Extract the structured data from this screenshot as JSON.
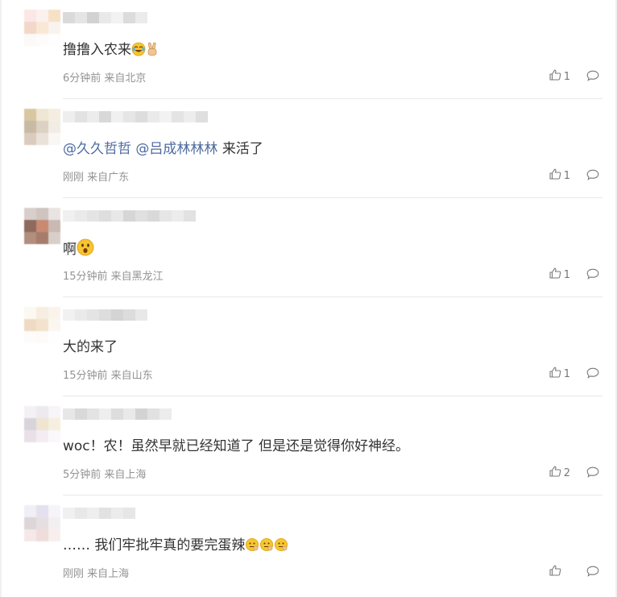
{
  "comments": [
    {
      "text": "撸撸入农来",
      "meta": "6分钟前 来自北京",
      "likes": "1",
      "avatar_colors": [
        "#fbe7e3",
        "#fbf1ee",
        "#f6e0c6",
        "#f3d7c9",
        "#fae8d7",
        "#f8f3ee",
        "#fcfaf7",
        "#fdfcfb",
        "#fefefe"
      ],
      "name_colors": [
        "#dadada",
        "#e5e5e5",
        "#d2d2d2",
        "#e9e9e9",
        "#f2f2f2",
        "#dcdcdc",
        "#ebebeb"
      ],
      "emojis": [
        "laughing-tears-emoji",
        "victory-hand-emoji"
      ]
    },
    {
      "mention1": "@久久哲哲",
      "mention2": "@吕成林林林",
      "text": "来活了",
      "meta": "刚刚 来自广东",
      "likes": "1",
      "avatar_colors": [
        "#d8c7a1",
        "#efe6d3",
        "#f4ede0",
        "#c9baa6",
        "#dcd1c2",
        "#f1ece4",
        "#d9ccbf",
        "#e9e2d9",
        "#f9f7f4"
      ],
      "name_colors": [
        "#eeeeee",
        "#e2e2e2",
        "#ececec",
        "#d8d8d8",
        "#f0f0f0",
        "#e6e6e6",
        "#dddddd",
        "#eaeaea",
        "#f2f2f2",
        "#e4e4e4",
        "#ededed",
        "#dfdfdf"
      ]
    },
    {
      "text": "啊",
      "meta": "15分钟前 来自黑龙江",
      "likes": "1",
      "avatar_colors": [
        "#d8cfcb",
        "#cfc4bf",
        "#e9e4e2",
        "#8f6a5e",
        "#c98a72",
        "#c9b9b2",
        "#b28e7f",
        "#a67d6c",
        "#d9cfc9"
      ],
      "name_colors": [
        "#f0f0f0",
        "#eaeaea",
        "#e4e4e4",
        "#dedede",
        "#e8e8e8",
        "#d6d6d6",
        "#e0e0e0",
        "#d9d9d9",
        "#e6e6e6",
        "#ececec",
        "#e2e2e2"
      ],
      "emojis": [
        "surprised-face-emoji"
      ]
    },
    {
      "text": "大的来了",
      "meta": "15分钟前 来自山东",
      "likes": "1",
      "avatar_colors": [
        "#fcf8f2",
        "#f7ede0",
        "#f9f3eb",
        "#efdbc4",
        "#f3e3ce",
        "#fbf6f0",
        "#fefcfa",
        "#fdfbf8",
        "#fefefe"
      ],
      "name_colors": [
        "#f1f1f1",
        "#eaeaea",
        "#e4e4e4",
        "#dddddd",
        "#d4d4d4",
        "#dcdcdc",
        "#e8e8e8"
      ]
    },
    {
      "text": "woc！农！虽然早就已经知道了 但是还是觉得你好神经。",
      "meta": "5分钟前 来自上海",
      "likes": "2",
      "avatar_colors": [
        "#f3f1f4",
        "#eceaef",
        "#f7f5f8",
        "#d9d3dc",
        "#efe5d2",
        "#f6eede",
        "#e9e0e8",
        "#f3ecf2",
        "#fbf8fb"
      ],
      "name_colors": [
        "#e7e7e7",
        "#d9d9d9",
        "#e3e3e3",
        "#eeeeee",
        "#dddddd",
        "#e9e9e9",
        "#d3d3d3",
        "#e1e1e1",
        "#ececec"
      ]
    },
    {
      "text": "…… 我们牢批牢真的要完蛋辣",
      "meta": "刚刚 来自上海",
      "likes": "",
      "avatar_colors": [
        "#f1eff6",
        "#e4e0ef",
        "#f6f4f9",
        "#dcd6d8",
        "#e6dfe2",
        "#f3eff0",
        "#f5e8e8",
        "#f1dcdc",
        "#f8eeee"
      ],
      "name_colors": [
        "#f0f0f0",
        "#e8e8e8",
        "#eeeeee",
        "#e2e2e2",
        "#ececec",
        "#e6e6e6"
      ],
      "emojis": [
        "pondering-face-emoji",
        "pondering-face-emoji",
        "pondering-face-emoji"
      ]
    }
  ]
}
